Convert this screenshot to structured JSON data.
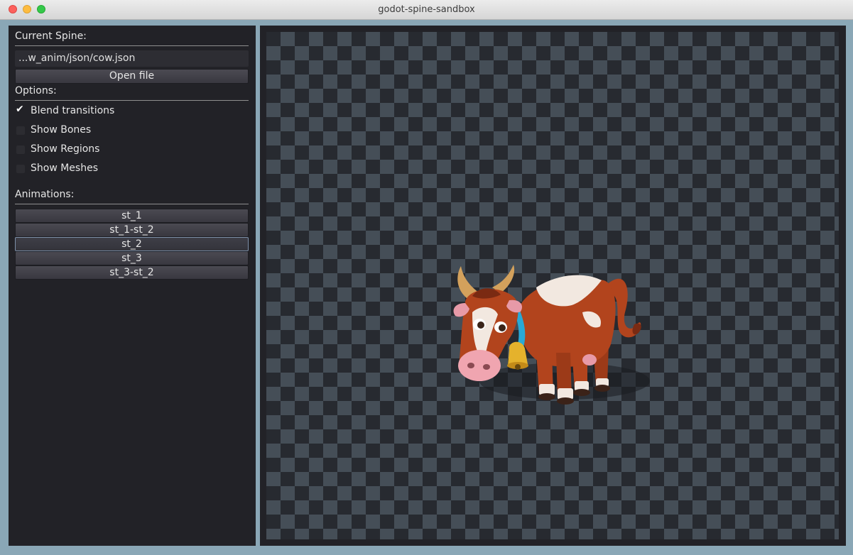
{
  "window": {
    "title": "godot-spine-sandbox"
  },
  "sidebar": {
    "current_spine_label": "Current Spine:",
    "file_path": "...w_anim/json/cow.json",
    "open_file_label": "Open file",
    "options_label": "Options:",
    "options": [
      {
        "label": "Blend transitions",
        "checked": true
      },
      {
        "label": "Show Bones",
        "checked": false
      },
      {
        "label": "Show Regions",
        "checked": false
      },
      {
        "label": "Show Meshes",
        "checked": false
      }
    ],
    "animations_label": "Animations:",
    "animations": [
      {
        "label": "st_1"
      },
      {
        "label": "st_1-st_2"
      },
      {
        "label": "st_2",
        "focused": true
      },
      {
        "label": "st_3"
      },
      {
        "label": "st_3-st_2"
      }
    ]
  },
  "colors": {
    "panel_bg": "#222227",
    "window_frame": "#8aa7b6",
    "checker_dark": "#272a30",
    "checker_light": "#454e57",
    "cow_body": "#b2441d",
    "cow_white": "#f2e8e0",
    "collar": "#29a9d6",
    "bell": "#e5b22c"
  }
}
